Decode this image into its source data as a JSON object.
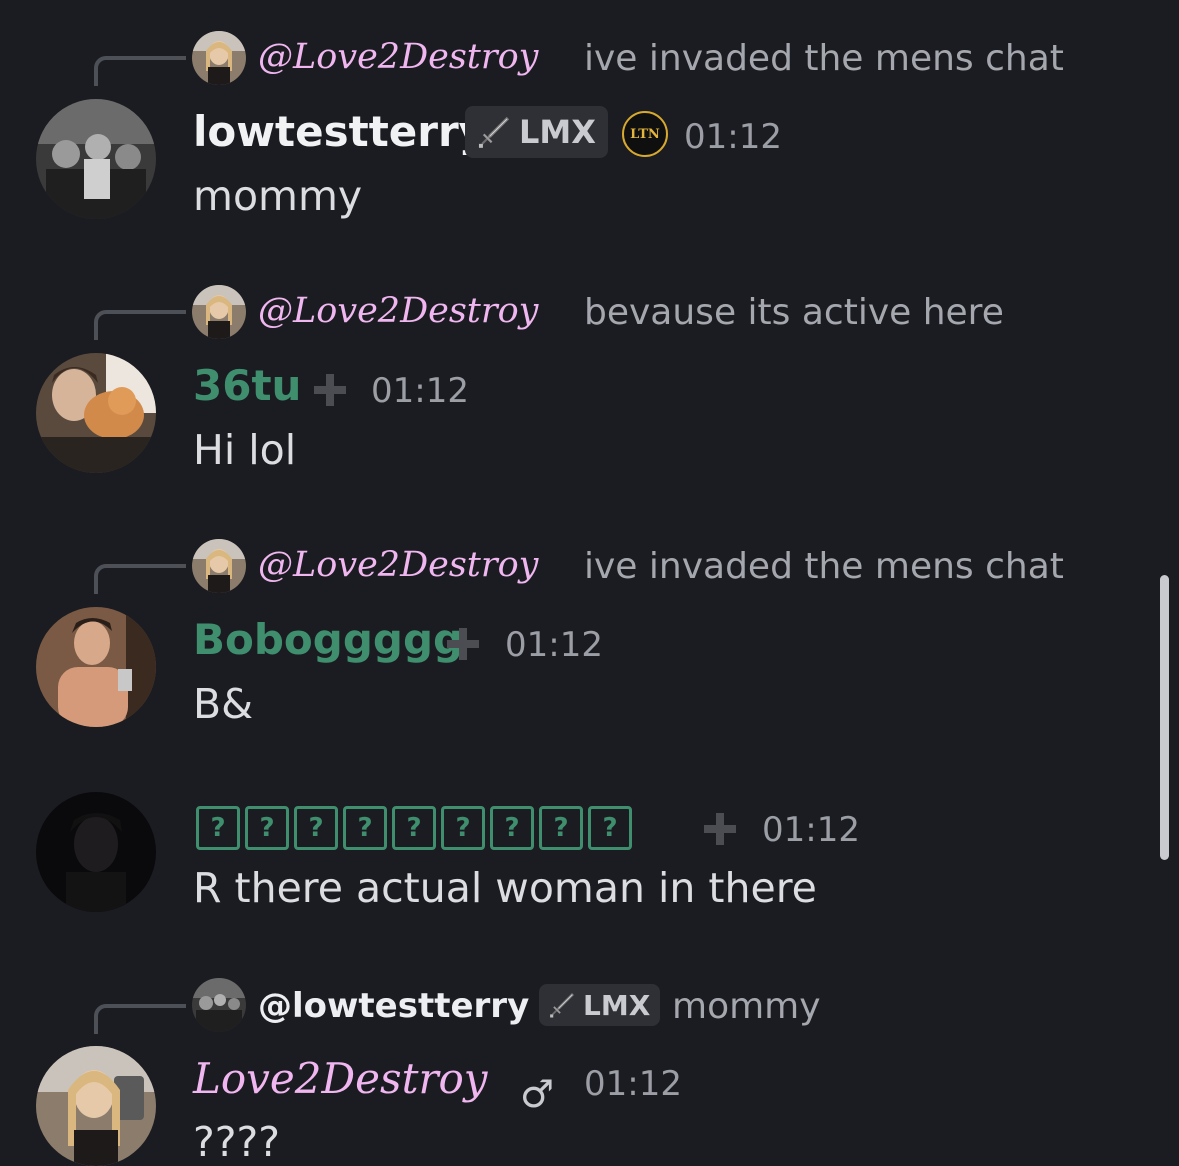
{
  "messages": [
    {
      "reply": {
        "name": "@Love2Destroy",
        "text": "ive invaded the mens chat",
        "avatar_icon": "avatar-love2destroy"
      },
      "author": "lowtestterry",
      "tag": "LMX",
      "badge": "LTN",
      "time": "01:12",
      "text": "mommy",
      "avatar_icon": "avatar-lowtestterry"
    },
    {
      "reply": {
        "name": "@Love2Destroy",
        "text": "bevause its active here",
        "avatar_icon": "avatar-love2destroy"
      },
      "author": "36tu",
      "time": "01:12",
      "text": "Hi lol",
      "avatar_icon": "avatar-36tu"
    },
    {
      "reply": {
        "name": "@Love2Destroy",
        "text": "ive invaded the mens chat",
        "avatar_icon": "avatar-love2destroy"
      },
      "author": "Boboggggg",
      "time": "01:12",
      "text": "B&",
      "avatar_icon": "avatar-boboggggg"
    },
    {
      "author_glyphs": [
        "?",
        "?",
        "?",
        "?",
        "?",
        "?",
        "?",
        "?",
        "?"
      ],
      "time": "01:12",
      "text": "R there actual woman in there",
      "avatar_icon": "avatar-dark"
    },
    {
      "reply": {
        "name": "@lowtestterry",
        "tag": "LMX",
        "text": "mommy",
        "avatar_icon": "avatar-lowtestterry"
      },
      "author": "Love2Destroy",
      "author_icon": "male-icon",
      "time": "01:12",
      "text": "????",
      "avatar_icon": "avatar-love2destroy"
    }
  ],
  "colors": {
    "background": "#1b1c21",
    "role_green": "#3f8f6f",
    "pink_name": "#efb6ef",
    "timestamp": "#9c9ea6",
    "tag_bg": "#2f3036"
  }
}
